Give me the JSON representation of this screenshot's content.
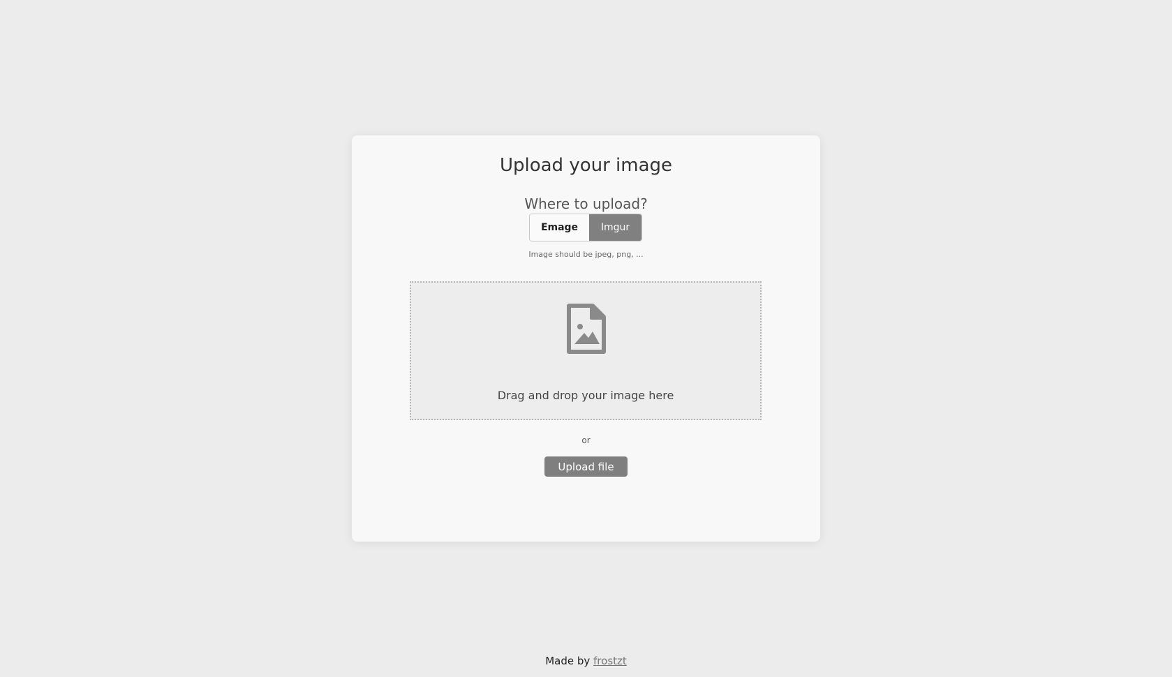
{
  "card": {
    "title": "Upload your image",
    "subtitle": "Where to upload?",
    "toggle": {
      "options": [
        "Emage",
        "Imgur"
      ],
      "selected": "Imgur"
    },
    "hint": "Image should be jpeg, png, ...",
    "dropzone": {
      "icon": "image-file-icon",
      "text": "Drag and drop your image here"
    },
    "or_text": "or",
    "upload_button": "Upload file"
  },
  "footer": {
    "prefix": "Made by ",
    "link_text": "frostzt"
  },
  "colors": {
    "background": "#ececec",
    "card": "#f8f8f8",
    "accent": "#808080"
  }
}
